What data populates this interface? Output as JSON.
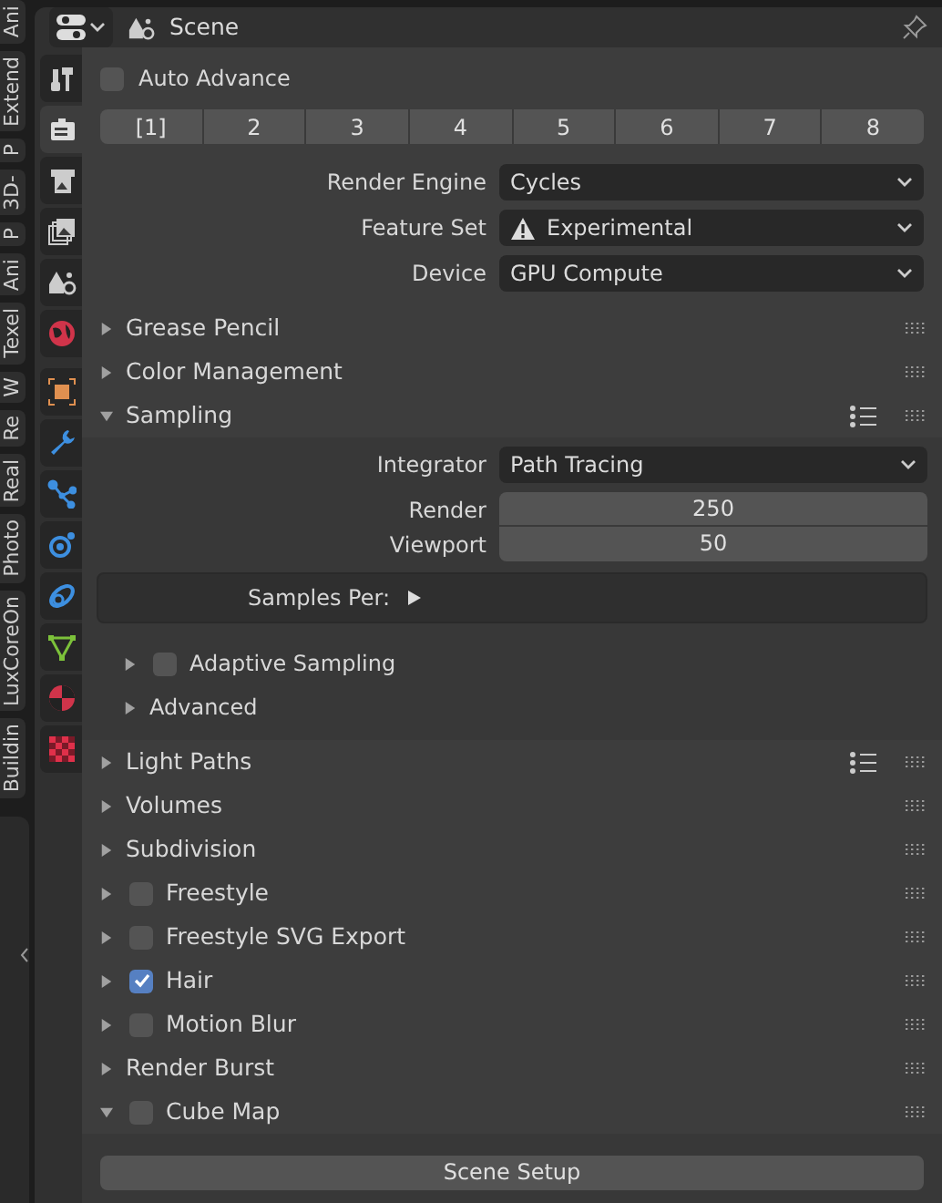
{
  "side_tabs": [
    {
      "label": "Ani"
    },
    {
      "label": "Extend"
    },
    {
      "label": "P"
    },
    {
      "label": "3D-"
    },
    {
      "label": "P"
    },
    {
      "label": "Ani"
    },
    {
      "label": "Texel"
    },
    {
      "label": "W"
    },
    {
      "label": "Re"
    },
    {
      "label": "Real"
    },
    {
      "label": "Photo"
    },
    {
      "label": "LuxCoreOn"
    },
    {
      "label": "Buildin"
    }
  ],
  "property_tabs": [
    {
      "kind": "tool",
      "selected": false
    },
    {
      "kind": "render",
      "selected": true
    },
    {
      "kind": "output",
      "selected": false
    },
    {
      "kind": "view_layer",
      "selected": false
    },
    {
      "kind": "scene",
      "selected": false
    },
    {
      "kind": "world",
      "selected": false
    },
    {
      "kind": "object",
      "selected": false
    },
    {
      "kind": "modifier",
      "selected": false
    },
    {
      "kind": "particles",
      "selected": false
    },
    {
      "kind": "physics",
      "selected": false
    },
    {
      "kind": "constraints",
      "selected": false
    },
    {
      "kind": "data",
      "selected": false
    },
    {
      "kind": "material",
      "selected": false
    },
    {
      "kind": "texture",
      "selected": false
    }
  ],
  "header": {
    "title": "Scene"
  },
  "auto_advance": {
    "label": "Auto Advance",
    "checked": false
  },
  "slots": [
    {
      "label": "[1]"
    },
    {
      "label": "2"
    },
    {
      "label": "3"
    },
    {
      "label": "4"
    },
    {
      "label": "5"
    },
    {
      "label": "6"
    },
    {
      "label": "7"
    },
    {
      "label": "8"
    }
  ],
  "properties": [
    {
      "label": "Render Engine",
      "value": "Cycles",
      "warning": false
    },
    {
      "label": "Feature Set",
      "value": "Experimental",
      "warning": true
    },
    {
      "label": "Device",
      "value": "GPU Compute",
      "warning": false
    }
  ],
  "panels": [
    {
      "label": "Grease Pencil",
      "expanded": false,
      "list_icon": false
    },
    {
      "label": "Color Management",
      "expanded": false,
      "list_icon": false
    },
    {
      "label": "Sampling",
      "expanded": true,
      "list_icon": true,
      "sampling": {
        "integrator": {
          "label": "Integrator",
          "value": "Path Tracing"
        },
        "samples": [
          {
            "label": "Render",
            "value": "250"
          },
          {
            "label": "Viewport",
            "value": "50"
          }
        ],
        "samples_per": {
          "label": "Samples Per:",
          "expanded": false
        },
        "subpanels": [
          {
            "label": "Adaptive Sampling",
            "expanded": false,
            "checked": false
          },
          {
            "label": "Advanced",
            "expanded": false
          }
        ]
      }
    },
    {
      "label": "Light Paths",
      "expanded": false,
      "list_icon": true
    },
    {
      "label": "Volumes",
      "expanded": false,
      "list_icon": false
    },
    {
      "label": "Subdivision",
      "expanded": false,
      "list_icon": false
    },
    {
      "label": "Freestyle",
      "expanded": false,
      "list_icon": false,
      "checked": false
    },
    {
      "label": "Freestyle SVG Export",
      "expanded": false,
      "list_icon": false,
      "checked": false
    },
    {
      "label": "Hair",
      "expanded": false,
      "list_icon": false,
      "checked": true
    },
    {
      "label": "Motion Blur",
      "expanded": false,
      "list_icon": false,
      "checked": false
    },
    {
      "label": "Render Burst",
      "expanded": false,
      "list_icon": false
    },
    {
      "label": "Cube Map",
      "expanded": true,
      "list_icon": false,
      "checked": false,
      "button": "Scene Setup"
    }
  ]
}
